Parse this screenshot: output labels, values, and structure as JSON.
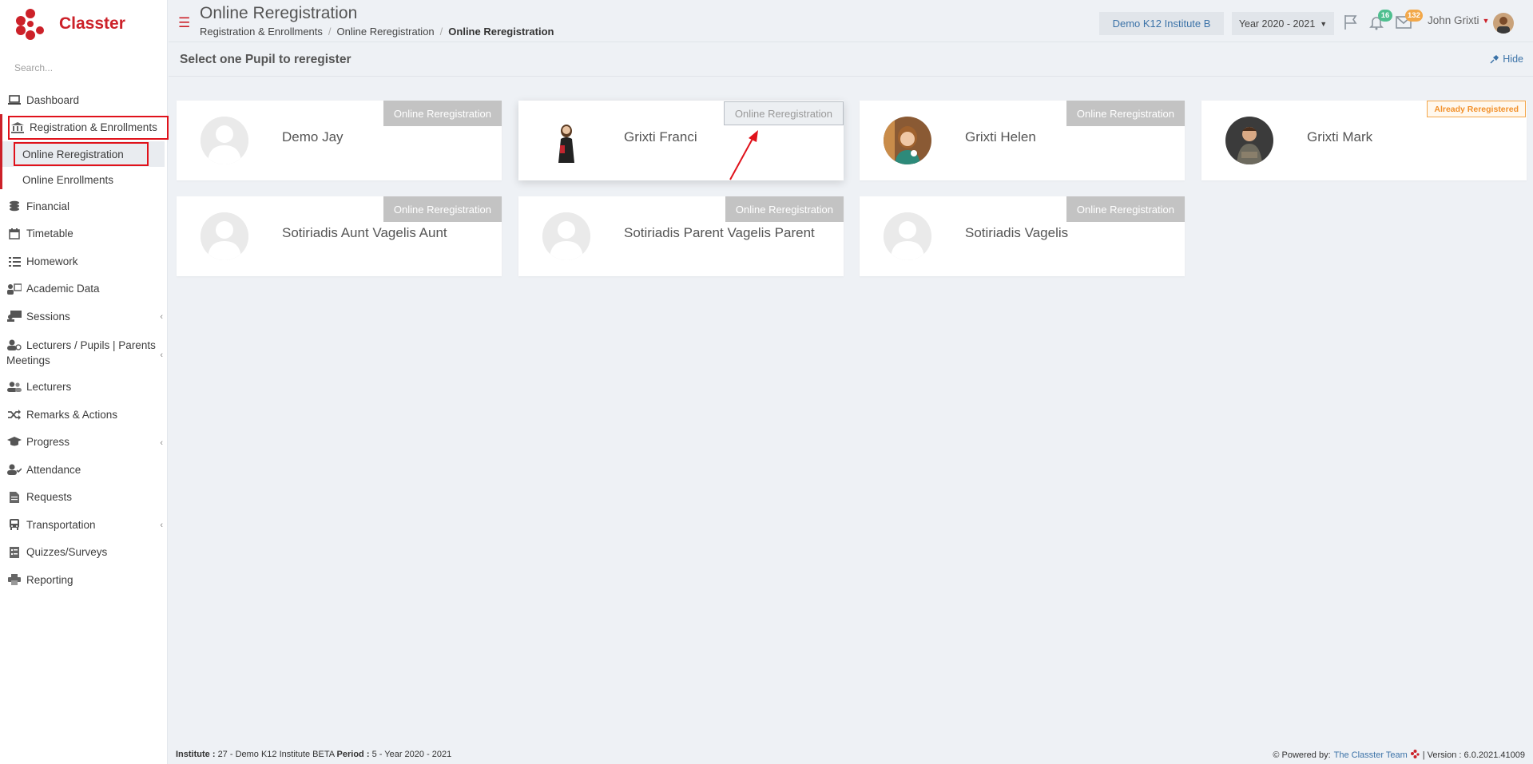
{
  "app": {
    "name": "Classter"
  },
  "search": {
    "placeholder": "Search..."
  },
  "sidebar": {
    "items": [
      {
        "label": "Dashboard"
      },
      {
        "label": "Registration & Enrollments"
      },
      {
        "label": "Online Reregistration"
      },
      {
        "label": "Online Enrollments"
      },
      {
        "label": "Financial"
      },
      {
        "label": "Timetable"
      },
      {
        "label": "Homework"
      },
      {
        "label": "Academic Data"
      },
      {
        "label": "Sessions"
      },
      {
        "label": "Lecturers / Pupils | Parents Meetings"
      },
      {
        "label": "Lecturers"
      },
      {
        "label": "Remarks & Actions"
      },
      {
        "label": "Progress"
      },
      {
        "label": "Attendance"
      },
      {
        "label": "Requests"
      },
      {
        "label": "Transportation"
      },
      {
        "label": "Quizzes/Surveys"
      },
      {
        "label": "Reporting"
      }
    ]
  },
  "header": {
    "title": "Online Reregistration",
    "breadcrumb": [
      "Registration & Enrollments",
      "Online Reregistration",
      "Online Reregistration"
    ],
    "institute": "Demo K12 Institute B",
    "year": "Year 2020 - 2021",
    "notifications_count": "16",
    "messages_count": "132",
    "user_name": "John Grixti"
  },
  "section": {
    "title": "Select one Pupil to reregister",
    "hide_label": "Hide"
  },
  "pupils": [
    {
      "name": "Demo Jay",
      "action": "Online Reregistration"
    },
    {
      "name": "Grixti Franci",
      "action": "Online Reregistration"
    },
    {
      "name": "Grixti Helen",
      "action": "Online Reregistration"
    },
    {
      "name": "Grixti Mark",
      "status": "Already Reregistered"
    },
    {
      "name": "Sotiriadis Aunt Vagelis Aunt",
      "action": "Online Reregistration"
    },
    {
      "name": "Sotiriadis Parent Vagelis Parent",
      "action": "Online Reregistration"
    },
    {
      "name": "Sotiriadis Vagelis",
      "action": "Online Reregistration"
    }
  ],
  "footer": {
    "institute_label": "Institute :",
    "institute_value": "27 - Demo K12 Institute BETA",
    "period_label": "Period :",
    "period_value": "5 - Year 2020 - 2021",
    "powered_label": "Powered by:",
    "powered_link": "The Classter Team",
    "version": "| Version : 6.0.2021.41009"
  },
  "colors": {
    "brand": "#cc2129",
    "link": "#3c73a8",
    "badge_notifications": "#4fbf8f",
    "badge_messages": "#f2a84a",
    "status_warning": "#f2902a"
  },
  "icons": [
    "laptop-icon",
    "bank-icon",
    "coins-icon",
    "calendar-icon",
    "list-icon",
    "academic-icon",
    "sessions-icon",
    "meeting-icon",
    "users-icon",
    "shuffle-icon",
    "graduation-cap-icon",
    "attendance-icon",
    "document-icon",
    "bus-icon",
    "survey-icon",
    "printer-icon",
    "flag-icon",
    "bell-icon",
    "envelope-icon",
    "pin-icon"
  ]
}
